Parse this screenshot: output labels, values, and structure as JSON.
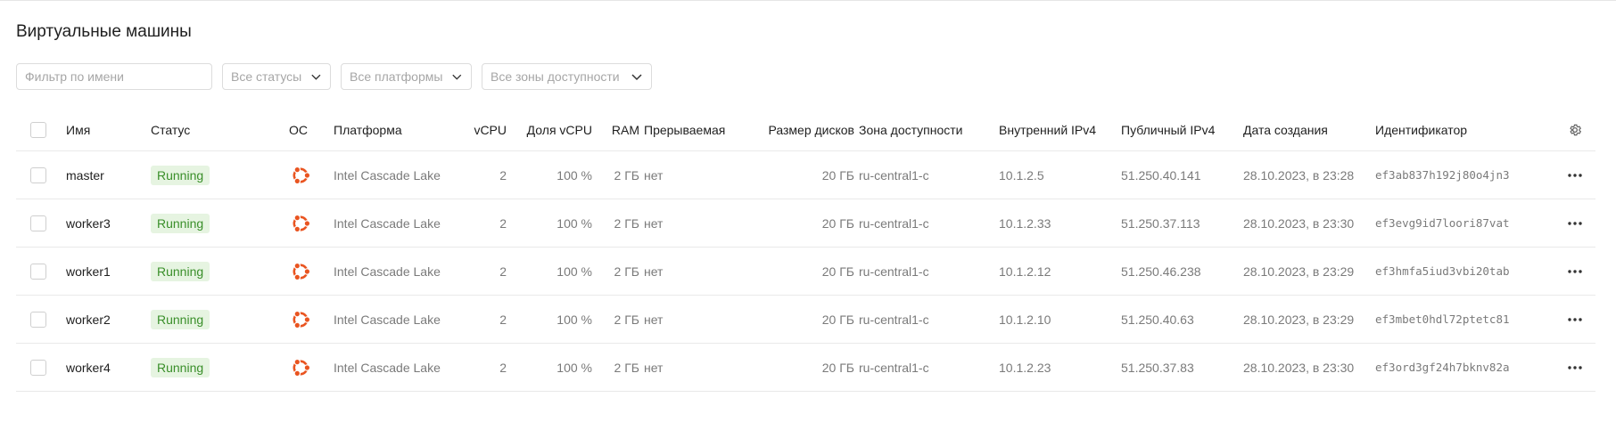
{
  "page": {
    "title": "Виртуальные машины"
  },
  "filters": {
    "name_placeholder": "Фильтр по имени",
    "status_select": "Все статусы",
    "platform_select": "Все платформы",
    "zone_select": "Все зоны доступности"
  },
  "table": {
    "columns": {
      "name": "Имя",
      "status": "Статус",
      "os": "ОС",
      "platform": "Платформа",
      "vcpu": "vCPU",
      "vcpu_share": "Доля vCPU",
      "ram": "RAM",
      "preemptible": "Прерываемая",
      "disk_size": "Размер дисков",
      "zone": "Зона доступности",
      "internal_ip": "Внутренний IPv4",
      "public_ip": "Публичный IPv4",
      "created": "Дата создания",
      "id": "Идентификатор"
    },
    "rows": [
      {
        "name": "master",
        "status": "Running",
        "os_icon": "ubuntu-icon",
        "platform": "Intel Cascade Lake",
        "vcpu": "2",
        "vcpu_share": "100 %",
        "ram": "2 ГБ",
        "preemptible": "нет",
        "disk_size": "20 ГБ",
        "zone": "ru-central1-c",
        "internal_ip": "10.1.2.5",
        "public_ip": "51.250.40.141",
        "created": "28.10.2023, в 23:28",
        "id": "ef3ab837h192j80o4jn3"
      },
      {
        "name": "worker3",
        "status": "Running",
        "os_icon": "ubuntu-icon",
        "platform": "Intel Cascade Lake",
        "vcpu": "2",
        "vcpu_share": "100 %",
        "ram": "2 ГБ",
        "preemptible": "нет",
        "disk_size": "20 ГБ",
        "zone": "ru-central1-c",
        "internal_ip": "10.1.2.33",
        "public_ip": "51.250.37.113",
        "created": "28.10.2023, в 23:30",
        "id": "ef3evg9id7loori87vat"
      },
      {
        "name": "worker1",
        "status": "Running",
        "os_icon": "ubuntu-icon",
        "platform": "Intel Cascade Lake",
        "vcpu": "2",
        "vcpu_share": "100 %",
        "ram": "2 ГБ",
        "preemptible": "нет",
        "disk_size": "20 ГБ",
        "zone": "ru-central1-c",
        "internal_ip": "10.1.2.12",
        "public_ip": "51.250.46.238",
        "created": "28.10.2023, в 23:29",
        "id": "ef3hmfa5iud3vbi20tab"
      },
      {
        "name": "worker2",
        "status": "Running",
        "os_icon": "ubuntu-icon",
        "platform": "Intel Cascade Lake",
        "vcpu": "2",
        "vcpu_share": "100 %",
        "ram": "2 ГБ",
        "preemptible": "нет",
        "disk_size": "20 ГБ",
        "zone": "ru-central1-c",
        "internal_ip": "10.1.2.10",
        "public_ip": "51.250.40.63",
        "created": "28.10.2023, в 23:29",
        "id": "ef3mbet0hdl72ptetc81"
      },
      {
        "name": "worker4",
        "status": "Running",
        "os_icon": "ubuntu-icon",
        "platform": "Intel Cascade Lake",
        "vcpu": "2",
        "vcpu_share": "100 %",
        "ram": "2 ГБ",
        "preemptible": "нет",
        "disk_size": "20 ГБ",
        "zone": "ru-central1-c",
        "internal_ip": "10.1.2.23",
        "public_ip": "51.250.37.83",
        "created": "28.10.2023, в 23:30",
        "id": "ef3ord3gf24h7bknv82a"
      }
    ]
  },
  "colors": {
    "status_running_bg": "#e6f4e1",
    "status_running_text": "#3a8f2a",
    "ubuntu_orange": "#e95420"
  }
}
